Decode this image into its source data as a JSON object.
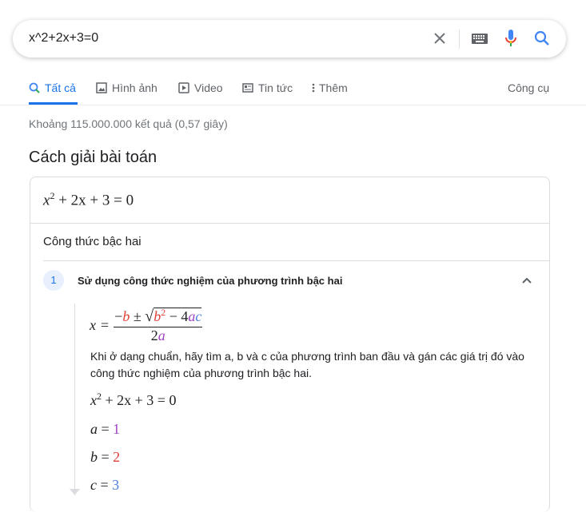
{
  "search": {
    "query": "x^2+2x+3=0"
  },
  "tabs": [
    {
      "label": "Tất cả",
      "icon": "search-icon"
    },
    {
      "label": "Hình ảnh",
      "icon": "image-icon"
    },
    {
      "label": "Video",
      "icon": "play-icon"
    },
    {
      "label": "Tin tức",
      "icon": "news-icon"
    },
    {
      "label": "Thêm",
      "icon": "more-vert-icon"
    }
  ],
  "tools_label": "Công cụ",
  "stats": "Khoảng 115.000.000 kết quả (0,57 giây)",
  "solver": {
    "title": "Cách giải bài toán",
    "equation": {
      "lhs": "x",
      "exp": "2",
      "rest": " + 2x + 3 = 0"
    },
    "method": "Công thức bậc hai",
    "step": {
      "number": "1",
      "title": "Sử dụng công thức nghiệm của phương trình bậc hai",
      "explanation": "Khi ở dạng chuẩn, hãy tìm a, b và c của phương trình ban đầu và gán các giá trị đó vào công thức nghiệm của phương trình bậc hai.",
      "a_value": "1",
      "b_value": "2",
      "c_value": "3"
    }
  },
  "colors": {
    "accent": "#1a73e8",
    "a": "#a142c1",
    "b": "#e0403a",
    "c": "#4a7fe0"
  }
}
